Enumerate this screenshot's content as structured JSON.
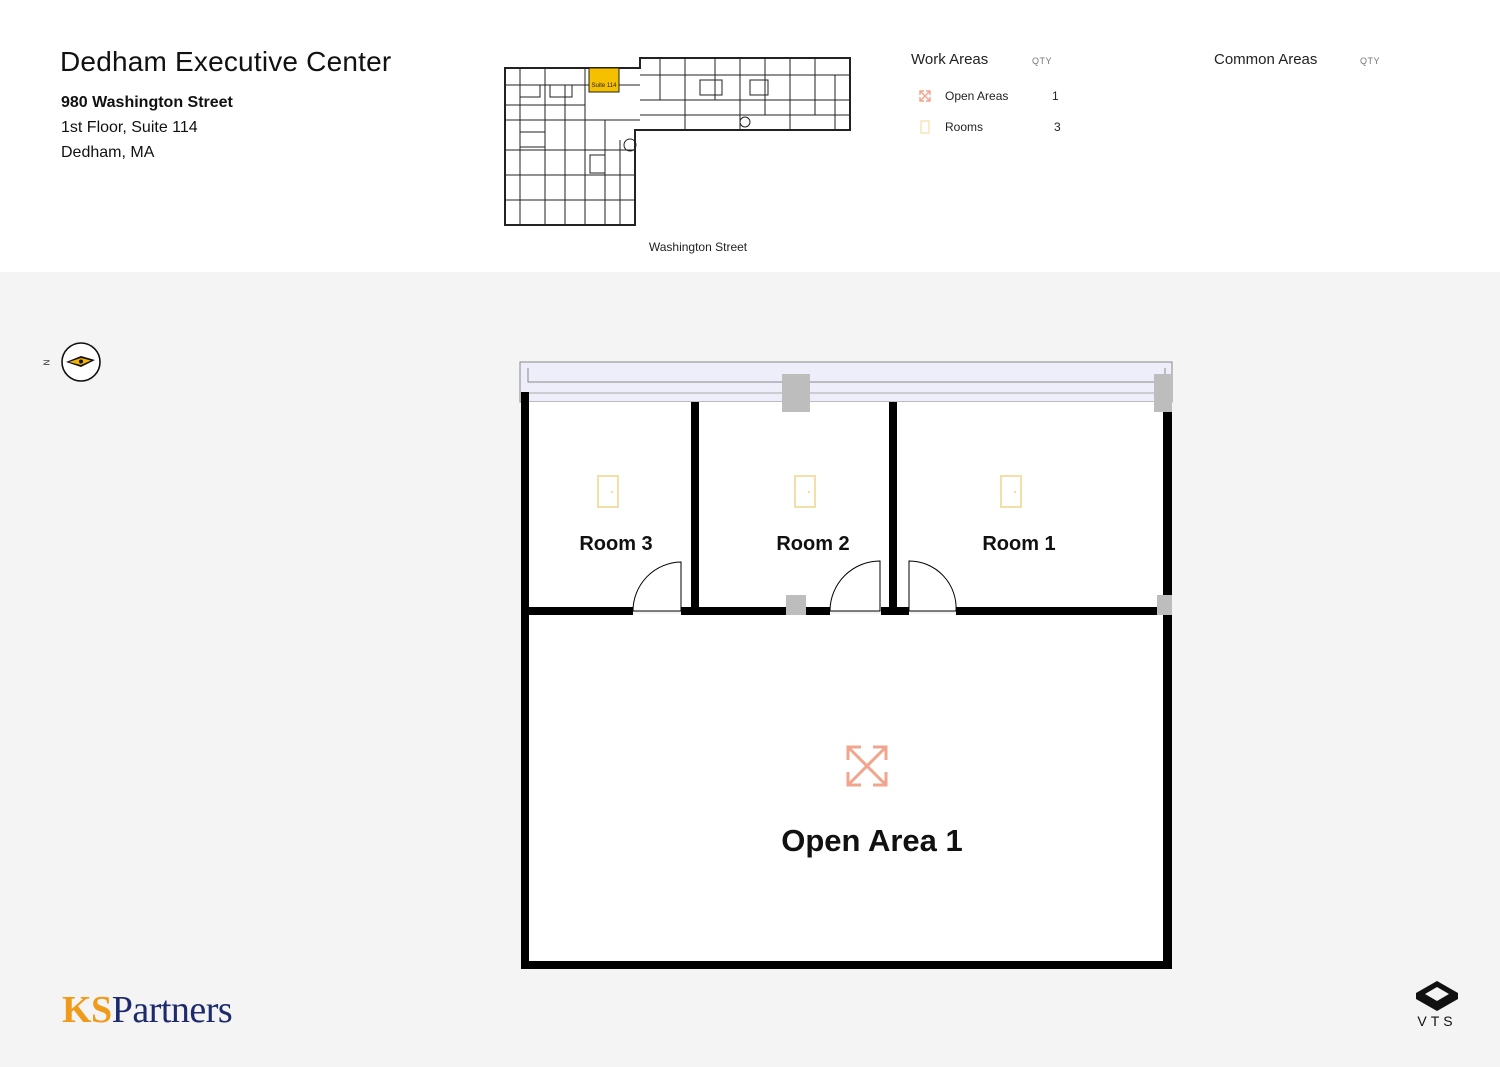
{
  "building": {
    "name": "Dedham Executive Center",
    "street": "980 Washington Street",
    "suite_line": "1st Floor, Suite 114",
    "city": "Dedham, MA"
  },
  "keymap": {
    "suite_label": "Suite 114",
    "street_caption": "Washington Street",
    "highlight_color": "#f5c000"
  },
  "legend": {
    "work_areas_title": "Work Areas",
    "common_areas_title": "Common Areas",
    "qty_label": "QTY",
    "items": [
      {
        "label": "Open Areas",
        "qty": "1",
        "icon": "arrows-expand-icon",
        "color": "#f0a58c"
      },
      {
        "label": "Rooms",
        "qty": "3",
        "icon": "door-icon",
        "color": "#f3dfa8"
      }
    ]
  },
  "compass": {
    "label": "N"
  },
  "floorplan": {
    "rooms": [
      {
        "label": "Room 3"
      },
      {
        "label": "Room 2"
      },
      {
        "label": "Room 1"
      }
    ],
    "open_area": {
      "label": "Open Area 1"
    }
  },
  "brand": {
    "ks": "KS",
    "partners": "Partners",
    "vts": "VTS"
  }
}
